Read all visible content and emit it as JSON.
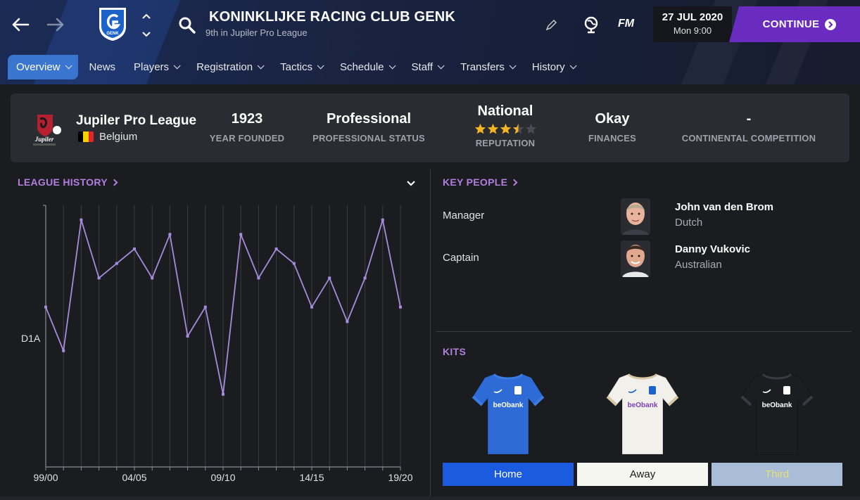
{
  "header": {
    "club_name": "KONINKLIJKE RACING CLUB GENK",
    "club_subtitle": "9th in Jupiler Pro League",
    "crest_text": "GENK",
    "fm_label": "FM",
    "date": "27 JUL 2020",
    "time": "Mon 9:00",
    "continue_label": "CONTINUE",
    "icons": [
      "back-arrow-icon",
      "forward-arrow-icon",
      "search-icon",
      "pencil-icon",
      "globe-icon"
    ]
  },
  "tabs": [
    {
      "label": "Overview",
      "dropdown": true,
      "active": true
    },
    {
      "label": "News",
      "dropdown": false,
      "active": false
    },
    {
      "label": "Players",
      "dropdown": true,
      "active": false
    },
    {
      "label": "Registration",
      "dropdown": true,
      "active": false
    },
    {
      "label": "Tactics",
      "dropdown": true,
      "active": false
    },
    {
      "label": "Schedule",
      "dropdown": true,
      "active": false
    },
    {
      "label": "Staff",
      "dropdown": true,
      "active": false
    },
    {
      "label": "Transfers",
      "dropdown": true,
      "active": false
    },
    {
      "label": "History",
      "dropdown": true,
      "active": false
    }
  ],
  "info": {
    "league": "Jupiler Pro League",
    "league_logo_text": "Jupiler",
    "country": "Belgium",
    "flag_colors": [
      "#000000",
      "#f5d300",
      "#e3242b"
    ],
    "year_founded": {
      "value": "1923",
      "label": "YEAR FOUNDED"
    },
    "status": {
      "value": "Professional",
      "label": "PROFESSIONAL STATUS"
    },
    "reputation": {
      "value": "National",
      "label": "REPUTATION",
      "stars": 3.5,
      "max_stars": 5
    },
    "finances": {
      "value": "Okay",
      "label": "FINANCES"
    },
    "continental": {
      "value": "-",
      "label": "CONTINENTAL COMPETITION"
    }
  },
  "league_history": {
    "title": "LEAGUE HISTORY"
  },
  "chart_data": {
    "type": "line",
    "title": "",
    "x": [
      "99/00",
      "00/01",
      "01/02",
      "02/03",
      "03/04",
      "04/05",
      "05/06",
      "06/07",
      "07/08",
      "08/09",
      "09/10",
      "10/11",
      "11/12",
      "12/13",
      "13/14",
      "14/15",
      "15/16",
      "16/17",
      "17/18",
      "18/19",
      "19/20"
    ],
    "tick_labels": [
      "99/00",
      "04/05",
      "09/10",
      "14/15",
      "19/20"
    ],
    "series": [
      {
        "values": [
          7,
          10,
          1,
          5,
          4,
          3,
          5,
          2,
          9,
          7,
          13,
          2,
          5,
          3,
          4,
          7,
          5,
          8,
          5,
          1,
          7
        ]
      }
    ],
    "ylabel": "",
    "y_category": "D1A",
    "ylim": [
      0,
      18
    ],
    "y_inverted": true,
    "grid": true,
    "color": "#a78bdc"
  },
  "key_people": {
    "title": "KEY PEOPLE",
    "people": [
      {
        "role": "Manager",
        "name": "John van den Brom",
        "nationality": "Dutch"
      },
      {
        "role": "Captain",
        "name": "Danny Vukovic",
        "nationality": "Australian"
      }
    ]
  },
  "kits": {
    "title": "KITS",
    "sponsor": "beObank",
    "items": [
      {
        "label": "Home",
        "shirt_color": "#2f6bd6",
        "btn_bg": "#1b5be0",
        "btn_fg": "#ffffff"
      },
      {
        "label": "Away",
        "shirt_color": "#f2f0ea",
        "btn_bg": "#f6f6f0",
        "btn_fg": "#1b1b1b"
      },
      {
        "label": "Third",
        "shirt_color": "#1c1d20",
        "btn_bg": "#a9bcd8",
        "btn_fg": "#e6e06a"
      }
    ]
  }
}
